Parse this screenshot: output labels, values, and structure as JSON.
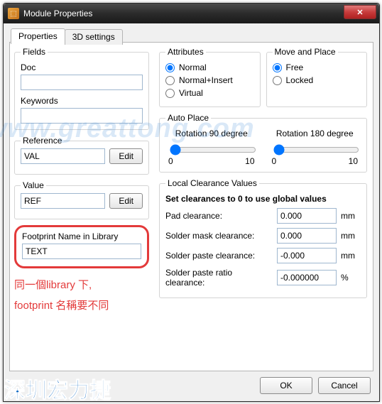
{
  "window": {
    "title": "Module Properties"
  },
  "tabs": {
    "active": "Properties",
    "inactive": "3D settings"
  },
  "fields": {
    "legend": "Fields",
    "doc_label": "Doc",
    "doc_value": "",
    "keywords_label": "Keywords",
    "keywords_value": ""
  },
  "reference": {
    "legend": "Reference",
    "value": "VAL",
    "edit": "Edit"
  },
  "value": {
    "legend": "Value",
    "value": "REF",
    "edit": "Edit"
  },
  "footprint": {
    "legend": "Footprint Name in Library",
    "value": "TEXT"
  },
  "annotation": {
    "line1": "同一個library 下,",
    "line2": "footprint 名稱要不同"
  },
  "attributes": {
    "legend": "Attributes",
    "options": [
      "Normal",
      "Normal+Insert",
      "Virtual"
    ],
    "selected": "Normal"
  },
  "moveplace": {
    "legend": "Move and Place",
    "options": [
      "Free",
      "Locked"
    ],
    "selected": "Free"
  },
  "autoplace": {
    "legend": "Auto Place",
    "rot90_label": "Rotation 90 degree",
    "rot180_label": "Rotation 180 degree",
    "min": "0",
    "max": "10"
  },
  "clearance": {
    "legend": "Local Clearance Values",
    "hint": "Set clearances to 0 to use global values",
    "rows": [
      {
        "label": "Pad clearance:",
        "value": "0.000",
        "unit": "mm"
      },
      {
        "label": "Solder mask clearance:",
        "value": "0.000",
        "unit": "mm"
      },
      {
        "label": "Solder paste clearance:",
        "value": "-0.000",
        "unit": "mm"
      },
      {
        "label": "Solder paste ratio clearance:",
        "value": "-0.000000",
        "unit": "%"
      }
    ]
  },
  "buttons": {
    "ok": "OK",
    "cancel": "Cancel"
  },
  "watermark": {
    "bg": "www.greattong.com",
    "bottom": "深圳宏力捷"
  }
}
